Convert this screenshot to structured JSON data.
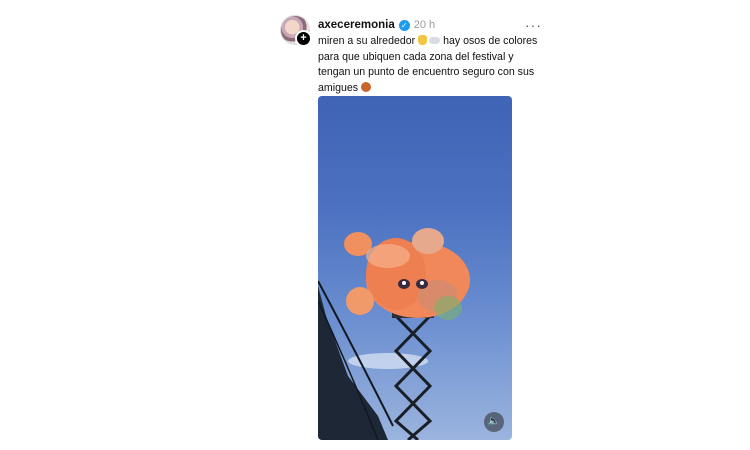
{
  "post": {
    "username": "axeceremonia",
    "time": "20 h",
    "more_icon": "more-horizontal-icon",
    "caption_line1_a": "miren a su alrededor",
    "caption_line1_b": "hay osos de colores",
    "caption_line2": "para que ubiquen cada zona del festival y",
    "caption_line3": "tengan un punto de encuentro seguro con sus",
    "caption_line4": "amigues",
    "media": {
      "type": "video",
      "description_icon": "video-frame",
      "mute_icon": "speaker-icon"
    }
  },
  "colors": {
    "verified": "#1d9bf0",
    "sky_top": "#3f63b5",
    "bear": "#f0885a"
  }
}
